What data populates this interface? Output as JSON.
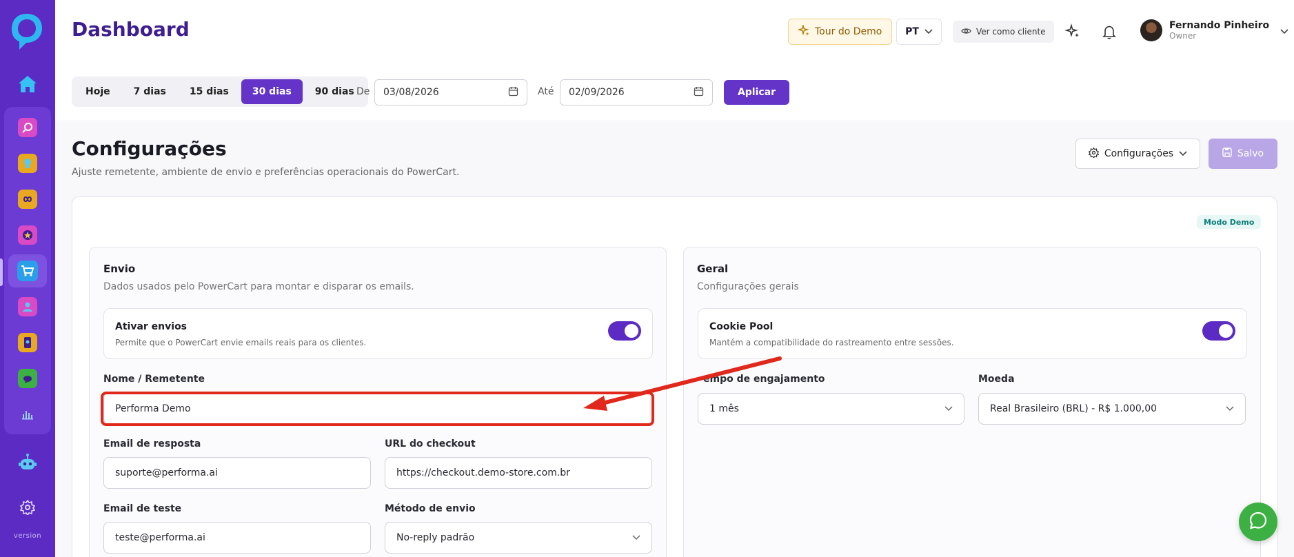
{
  "header": {
    "page_title": "Dashboard",
    "tour_label": "Tour do Demo",
    "lang_label": "PT",
    "view_client_label": "Ver como cliente",
    "user": {
      "name": "Fernando Pinheiro",
      "role": "Owner"
    }
  },
  "date_range": {
    "presets": [
      "Hoje",
      "7 dias",
      "15 dias",
      "30 dias",
      "90 dias"
    ],
    "active": "30 dias",
    "from_label": "De",
    "from_value": "03/08/2026",
    "to_label": "Até",
    "to_value": "02/09/2026",
    "apply_label": "Aplicar"
  },
  "sidebar": {
    "version_label": "version"
  },
  "page": {
    "title": "Configurações",
    "subtitle": "Ajuste remetente, ambiente de envio e preferências operacionais do PowerCart.",
    "config_menu_label": "Configurações",
    "save_label": "Salvo",
    "demo_badge": "Modo Demo"
  },
  "envio": {
    "title": "Envio",
    "subtitle": "Dados usados pelo PowerCart para montar e disparar os emails.",
    "toggle_title": "Ativar envios",
    "toggle_sub": "Permite que o PowerCart envie emails reais para os clientes.",
    "toggle_on": true,
    "sender_label": "Nome / Remetente",
    "sender_value": "Performa Demo",
    "reply_label": "Email de resposta",
    "reply_value": "suporte@performa.ai",
    "checkout_label": "URL do checkout",
    "checkout_value": "https://checkout.demo-store.com.br",
    "test_label": "Email de teste",
    "test_value": "teste@performa.ai",
    "method_label": "Método de envio",
    "method_value": "No-reply padrão"
  },
  "geral": {
    "title": "Geral",
    "subtitle": "Configurações gerais",
    "toggle_title": "Cookie Pool",
    "toggle_sub": "Mantém a compatibilidade do rastreamento entre sessões.",
    "toggle_on": true,
    "engagement_label": "empo de engajamento",
    "engagement_value": "1 mês",
    "currency_label": "Moeda",
    "currency_value": "Real Brasileiro (BRL) - R$ 1.000,00"
  },
  "colors": {
    "brand": "#5b2bc4",
    "accent": "#6334c7",
    "annotation": "#e0281c",
    "whatsapp": "#3cb043"
  }
}
